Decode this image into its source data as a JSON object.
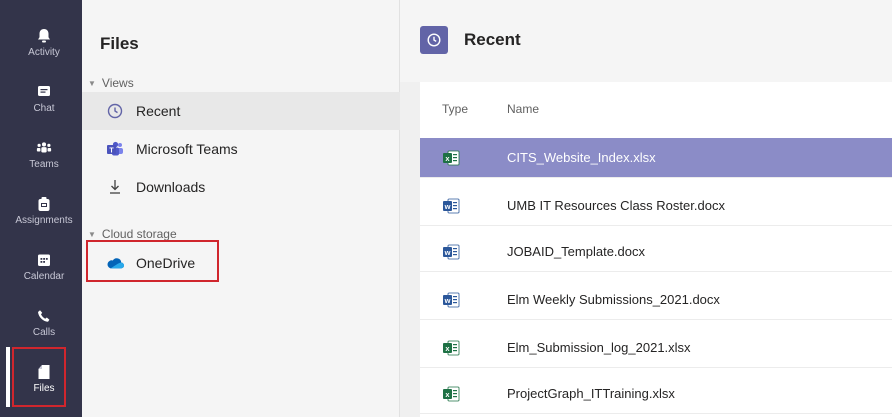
{
  "rail": {
    "items": [
      {
        "label": "Activity",
        "icon": "bell-icon"
      },
      {
        "label": "Chat",
        "icon": "chat-icon"
      },
      {
        "label": "Teams",
        "icon": "teams-icon"
      },
      {
        "label": "Assignments",
        "icon": "assignments-icon"
      },
      {
        "label": "Calendar",
        "icon": "calendar-icon"
      },
      {
        "label": "Calls",
        "icon": "phone-icon"
      },
      {
        "label": "Files",
        "icon": "file-icon"
      }
    ],
    "active": "Files"
  },
  "files_pane": {
    "title": "Files",
    "views_heading": "Views",
    "views": [
      {
        "label": "Recent",
        "icon": "clock-icon"
      },
      {
        "label": "Microsoft Teams",
        "icon": "microsoft-teams-icon"
      },
      {
        "label": "Downloads",
        "icon": "download-icon"
      }
    ],
    "cloud_heading": "Cloud storage",
    "cloud": [
      {
        "label": "OneDrive",
        "icon": "onedrive-cloud-icon"
      }
    ]
  },
  "main": {
    "title": "Recent",
    "columns": {
      "type": "Type",
      "name": "Name"
    },
    "files": [
      {
        "name": "CITS_Website_Index.xlsx",
        "type": "excel"
      },
      {
        "name": "UMB IT Resources Class Roster.docx",
        "type": "word"
      },
      {
        "name": "JOBAID_Template.docx",
        "type": "word"
      },
      {
        "name": "Elm Weekly Submissions_2021.docx",
        "type": "word"
      },
      {
        "name": "Elm_Submission_log_2021.xlsx",
        "type": "excel"
      },
      {
        "name": "ProjectGraph_ITTraining.xlsx",
        "type": "excel"
      }
    ],
    "selected_index": 0
  },
  "colors": {
    "rail_bg": "#33344a",
    "accent": "#6264a7",
    "selected_row": "#8b8cc7",
    "highlight_box": "#d0262d",
    "excel_green": "#1e7145",
    "word_blue": "#2b579a"
  }
}
